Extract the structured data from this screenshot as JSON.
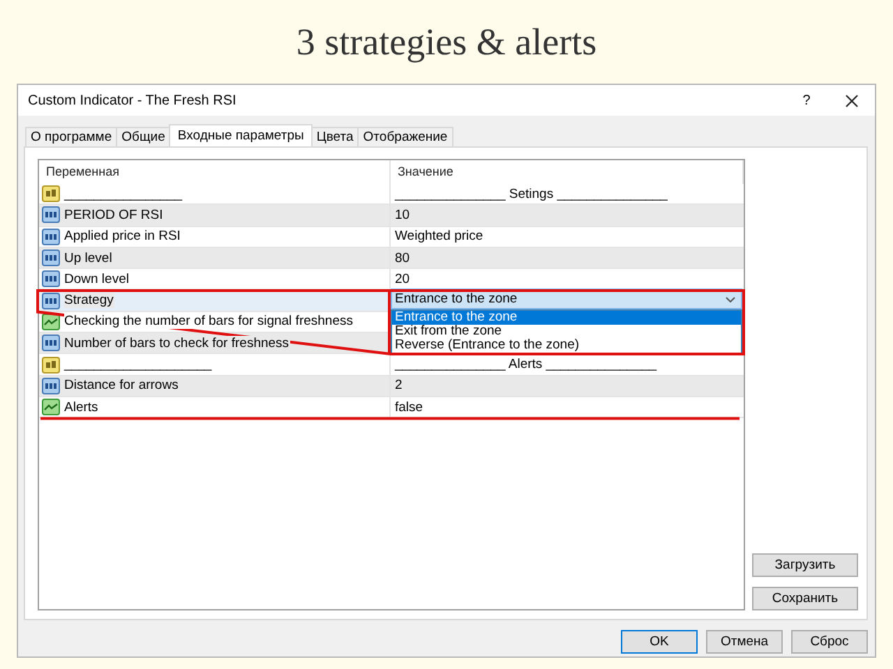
{
  "headline": "3 strategies & alerts",
  "window": {
    "title": "Custom Indicator - The Fresh RSI",
    "help": "?"
  },
  "tabs": [
    {
      "label": "О программе",
      "selected": false
    },
    {
      "label": "Общие",
      "selected": false
    },
    {
      "label": "Входные параметры",
      "selected": true
    },
    {
      "label": "Цвета",
      "selected": false
    },
    {
      "label": "Отображение",
      "selected": false
    }
  ],
  "table": {
    "columns": [
      "Переменная",
      "Значение"
    ],
    "rows": [
      {
        "kind": "text",
        "name": "________________",
        "value": "_______________ Setings _______________",
        "selected": false
      },
      {
        "kind": "number",
        "name": "PERIOD OF RSI",
        "value": "10",
        "selected": false
      },
      {
        "kind": "number",
        "name": "Applied price in RSI",
        "value": "Weighted price",
        "selected": false
      },
      {
        "kind": "number",
        "name": "Up level",
        "value": "80",
        "selected": false
      },
      {
        "kind": "number",
        "name": "Down level",
        "value": "20",
        "selected": false
      },
      {
        "kind": "number",
        "name": "Strategy",
        "selected": true,
        "combo": {
          "value": "Entrance to the zone",
          "options": [
            {
              "label": "Entrance to the zone",
              "selected": true
            },
            {
              "label": "Exit from the zone",
              "selected": false
            },
            {
              "label": "Reverse (Entrance to the zone)",
              "selected": false
            }
          ]
        }
      },
      {
        "kind": "bool",
        "name": "Checking the number of bars for signal freshness",
        "selected": false
      },
      {
        "kind": "number",
        "name": "Number of bars to check for freshness",
        "selected": false
      },
      {
        "kind": "text",
        "name": "____________________",
        "value": "_______________ Alerts _______________",
        "selected": false
      },
      {
        "kind": "number",
        "name": "Distance for arrows",
        "value": "2",
        "selected": false
      },
      {
        "kind": "bool",
        "name": "Alerts",
        "value": "false",
        "selected": false
      }
    ]
  },
  "side_buttons": [
    "Загрузить",
    "Сохранить"
  ],
  "buttons": [
    "OK",
    "Отмена",
    "Сброс"
  ]
}
